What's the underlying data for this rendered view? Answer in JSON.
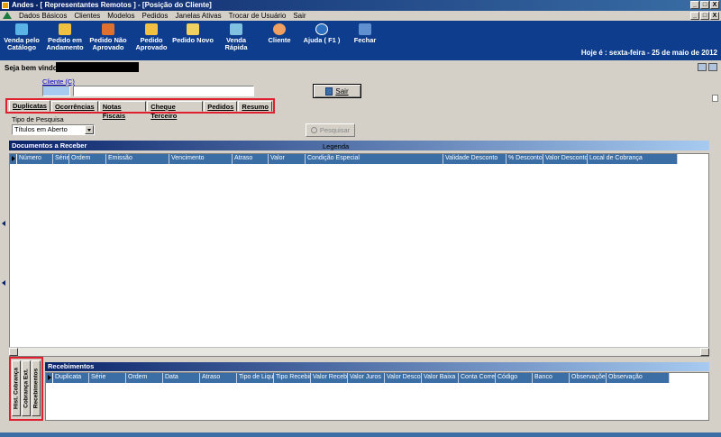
{
  "window": {
    "title": "Andes - [ Representantes Remotos ] - [Posição do Cliente]",
    "controls": [
      "_",
      "□",
      "X"
    ]
  },
  "menu": {
    "items": [
      "Dados Básicos",
      "Clientes",
      "Modelos",
      "Pedidos",
      "Janelas Ativas",
      "Trocar de Usuário",
      "Sair"
    ],
    "mdi_controls": [
      "_",
      "□",
      "X"
    ]
  },
  "toolbar": {
    "items": [
      {
        "label": "Venda pelo Catálogo",
        "icon": "catalog-icon",
        "color": "#5ab4e6"
      },
      {
        "label": "Pedido em Andamento",
        "icon": "order-progress-icon",
        "color": "#f0c040"
      },
      {
        "label": "Pedido Não Aprovado",
        "icon": "order-rejected-icon",
        "color": "#e07030"
      },
      {
        "label": "Pedido Aprovado",
        "icon": "order-approved-icon",
        "color": "#f0c040"
      },
      {
        "label": "Pedido Novo",
        "icon": "new-order-icon",
        "color": "#f0d060"
      },
      {
        "label": "Venda Rápida",
        "icon": "quick-sale-icon",
        "color": "#80c0e0"
      },
      {
        "label": "Cliente",
        "icon": "client-icon",
        "color": "#f0a060"
      },
      {
        "label": "Ajuda ( F1 )",
        "icon": "help-icon",
        "color": "#3070c0"
      },
      {
        "label": "Fechar",
        "icon": "close-door-icon",
        "color": "#6090d0"
      }
    ],
    "today": "Hoje é : sexta-feira - 25 de maio de 2012"
  },
  "header": {
    "welcome": "Seja bem vindo",
    "cliente_label": "Cliente (C)",
    "cliente_code": "",
    "cliente_name": "",
    "sair_label": "Sair"
  },
  "tabs": [
    {
      "label": "Duplicatas",
      "active": true
    },
    {
      "label": "Ocorrências",
      "active": false
    },
    {
      "label": "Notas Fiscais",
      "active": false
    },
    {
      "label": "Cheque Terceiro",
      "active": false
    },
    {
      "label": "Pedidos",
      "active": false
    },
    {
      "label": "Resumo",
      "active": false
    }
  ],
  "filter": {
    "tipo_label": "Tipo de Pesquisa",
    "tipo_value": "Títulos em Aberto",
    "pesquisar_label": "Pesquisar"
  },
  "documentos": {
    "title": "Documentos a Receber",
    "legenda": "Legenda",
    "columns": [
      "Número",
      "Série",
      "Ordem",
      "Emissão",
      "Vencimento",
      "Atraso",
      "Valor",
      "Condição Especial",
      "Validade Desconto",
      "% Desconto",
      "Valor Desconto",
      "Local de Cobrança"
    ]
  },
  "side_tabs": [
    "Hist. Cobrança",
    "Cobrança Ext.",
    "Recebimentos"
  ],
  "recebimentos": {
    "title": "Recebimentos",
    "columns": [
      "Duplicata",
      "Série",
      "Ordem",
      "Data",
      "Atraso",
      "Tipo de Liqui",
      "Tipo Recebir",
      "Valor Recebi",
      "Valor Juros",
      "Valor Descor",
      "Valor Baixa",
      "Conta Corren",
      "Código",
      "Banco",
      "Observações",
      "Observação"
    ]
  }
}
